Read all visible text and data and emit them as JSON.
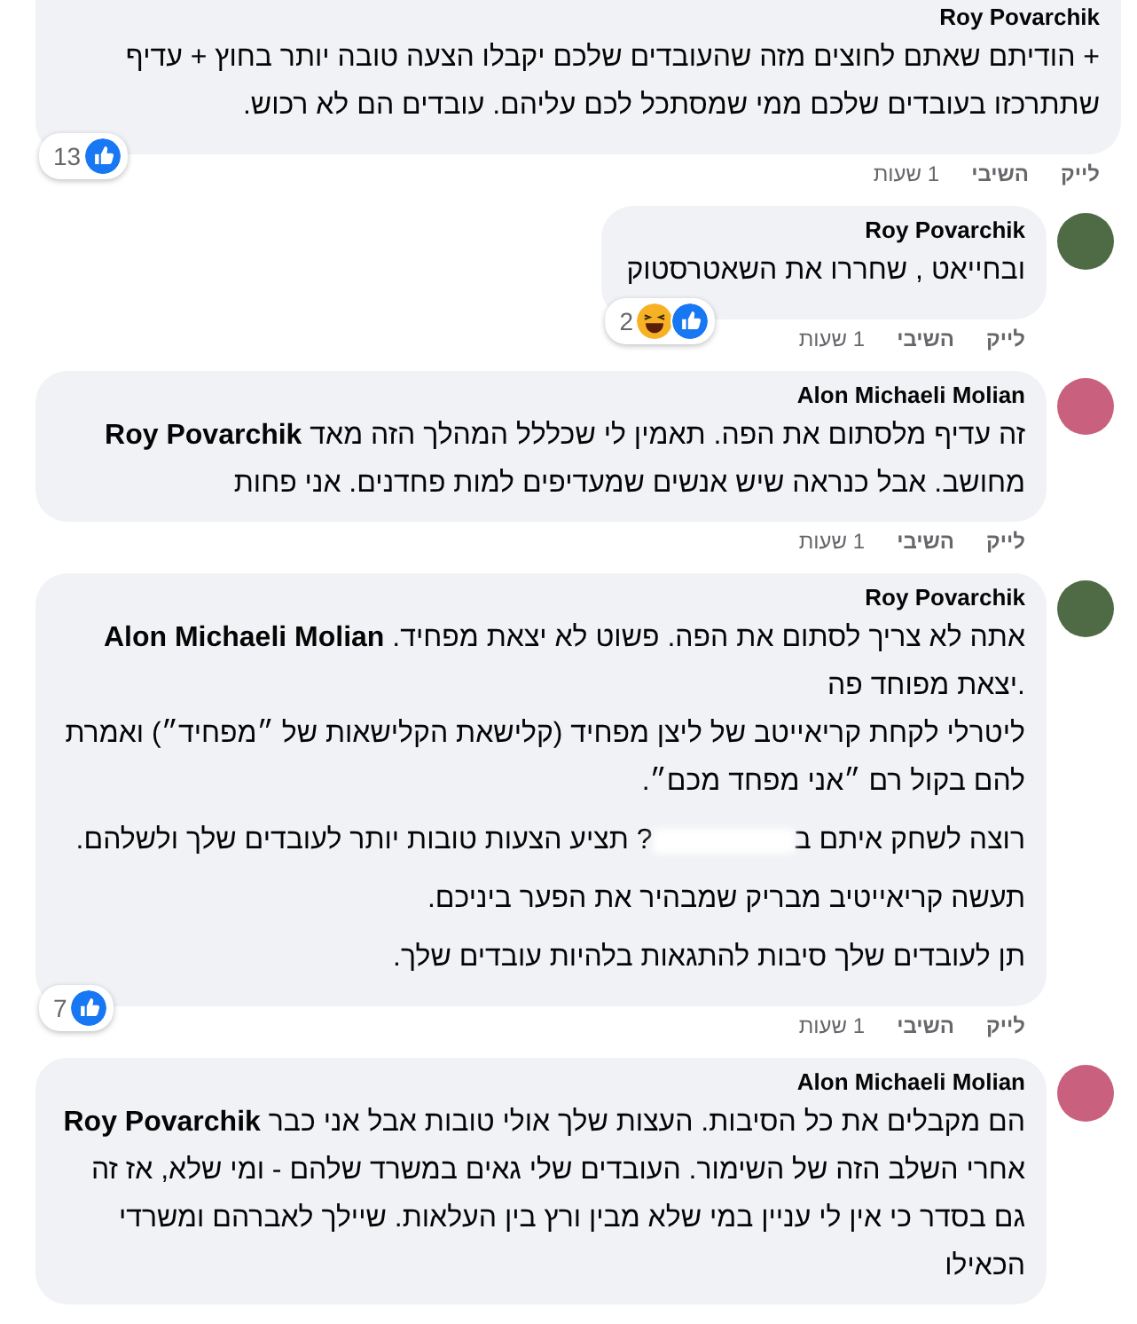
{
  "comments": [
    {
      "author": "Roy Povarchik",
      "paragraphs": [
        [
          {
            "kind": "text",
            "text": "+ הודיתם שאתם לחוצים מזה שהעובדים שלכם יקבלו הצעה טובה יותר בחוץ + עדיף שתתרכזו בעובדים שלכם ממי שמסתכל לכם עליהם. עובדים הם לא רכוש."
          }
        ]
      ],
      "reactions": {
        "count": "13",
        "icons": [
          {
            "kind": "like"
          }
        ]
      },
      "actions": {
        "like": "לייק",
        "reply": "השיבי",
        "time": "1 שעות"
      }
    },
    {
      "author": "Roy Povarchik",
      "color": "#4f6b45",
      "paragraphs": [
        [
          {
            "kind": "text",
            "text": "ובחייאט , שחררו את השאטרסטוק"
          }
        ]
      ],
      "reactions": {
        "count": "2",
        "icons": [
          {
            "kind": "haha"
          },
          {
            "kind": "like"
          }
        ]
      },
      "actions": {
        "like": "לייק",
        "reply": "השיבי",
        "time": "1 שעות"
      }
    },
    {
      "author": "Alon Michaeli Molian",
      "color": "#c8607e",
      "paragraphs": [
        [
          {
            "kind": "text",
            "text": "**Roy Povarchik** זה עדיף מלסתום את הפה. תאמין לי שכללל המהלך הזה מאד מחושב. אבל כנראה שיש אנשים שמעדיפים למות פחדנים. אני פחות"
          }
        ]
      ],
      "actions": {
        "like": "לייק",
        "reply": "השיבי",
        "time": "1 שעות"
      }
    },
    {
      "author": "Roy Povarchik",
      "color": "#4f6b45",
      "paragraphs": [
        [
          {
            "kind": "text",
            "text": "**Alon Michaeli Molian** אתה לא צריך לסתום את הפה. פשוט לא יצאת מפחיד. יצאת מפוחד פה."
          },
          {
            "kind": "text",
            "text": "ליטרלי לקחת קריאייטב של ליצן מפחיד (קלישאת הקלישאות של ״מפחיד״) ואמרת להם בקול רם ״אני מפחד מכם״."
          }
        ],
        [
          {
            "kind": "text",
            "text": "רוצה לשחק איתם ב"
          },
          {
            "kind": "redacted"
          },
          {
            "kind": "text",
            "text": "? תציע הצעות טובות יותר לעובדים שלך ולשלהם."
          }
        ],
        [
          {
            "kind": "text",
            "text": "תעשה קריאייטיב מבריק שמבהיר את הפער ביניכם."
          }
        ],
        [
          {
            "kind": "text",
            "text": "תן לעובדים שלך סיבות להתגאות בלהיות עובדים שלך."
          }
        ]
      ],
      "reactions": {
        "count": "7",
        "icons": [
          {
            "kind": "like"
          }
        ]
      },
      "actions": {
        "like": "לייק",
        "reply": "השיבי",
        "time": "1 שעות"
      }
    },
    {
      "author": "Alon Michaeli Molian",
      "color": "#c8607e",
      "paragraphs": [
        [
          {
            "kind": "text",
            "text": "**Roy Povarchik** הם מקבלים את כל הסיבות. העצות שלך אולי טובות אבל אני כבר אחרי השלב הזה של השימור. העובדים שלי גאים במשרד שלהם - ומי שלא, אז זה גם בסדר כי אין לי עניין במי שלא מבין ורץ בין העלאות. שיילך לאברהם ומשרדי הכאילו"
          }
        ]
      ]
    }
  ]
}
